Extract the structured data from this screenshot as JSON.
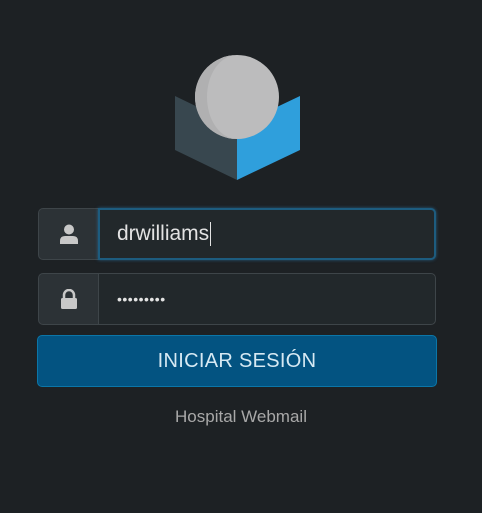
{
  "logo": {
    "icon": "roundcube-logo-icon"
  },
  "login_form": {
    "username": {
      "value": "drwilliams",
      "icon": "user-icon"
    },
    "password": {
      "masked_value": "•••••••••",
      "icon": "lock-icon"
    },
    "submit_label": "INICIAR SESIÓN"
  },
  "footer": {
    "text": "Hospital Webmail"
  },
  "colors": {
    "background": "#1d2124",
    "button": "#035381",
    "logo_blue": "#2f9fdc",
    "logo_dark": "#38474f",
    "logo_ball": "#c0c0c0"
  }
}
